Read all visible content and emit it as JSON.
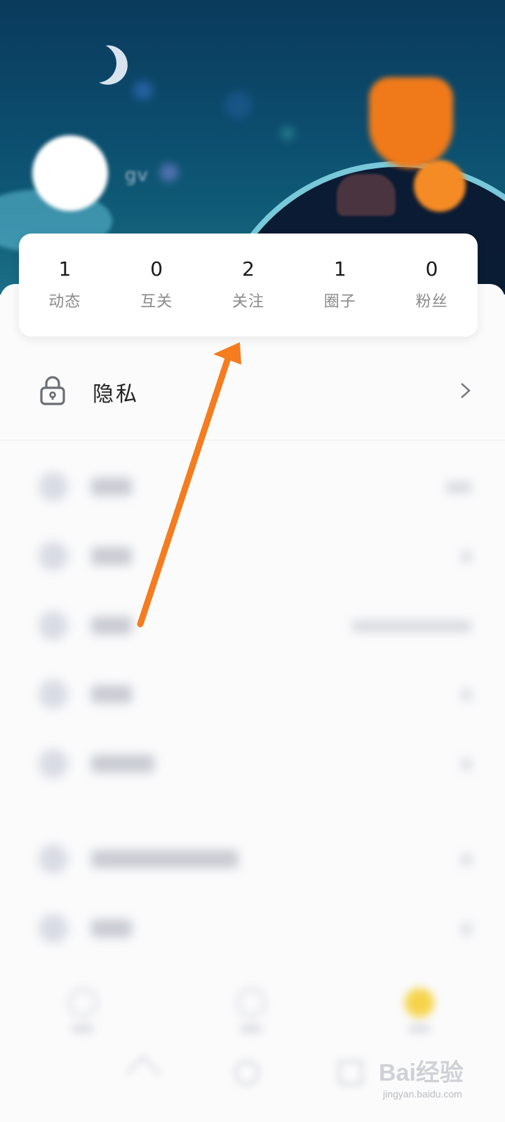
{
  "profile": {
    "username": "gv"
  },
  "stats": [
    {
      "value": "1",
      "label": "动态"
    },
    {
      "value": "0",
      "label": "互关"
    },
    {
      "value": "2",
      "label": "关注"
    },
    {
      "value": "1",
      "label": "圈子"
    },
    {
      "value": "0",
      "label": "粉丝"
    }
  ],
  "menu": {
    "privacy_label": "隐私",
    "privacy_icon": "lock-icon",
    "chevron_icon": "chevron-right-icon"
  },
  "annotation": {
    "arrow_color": "#f57c1f"
  },
  "watermark": {
    "main": "Bai经验",
    "sub": "jingyan.baidu.com"
  },
  "colors": {
    "header_bg": "#0c4d6e",
    "accent": "#f5d44b"
  }
}
